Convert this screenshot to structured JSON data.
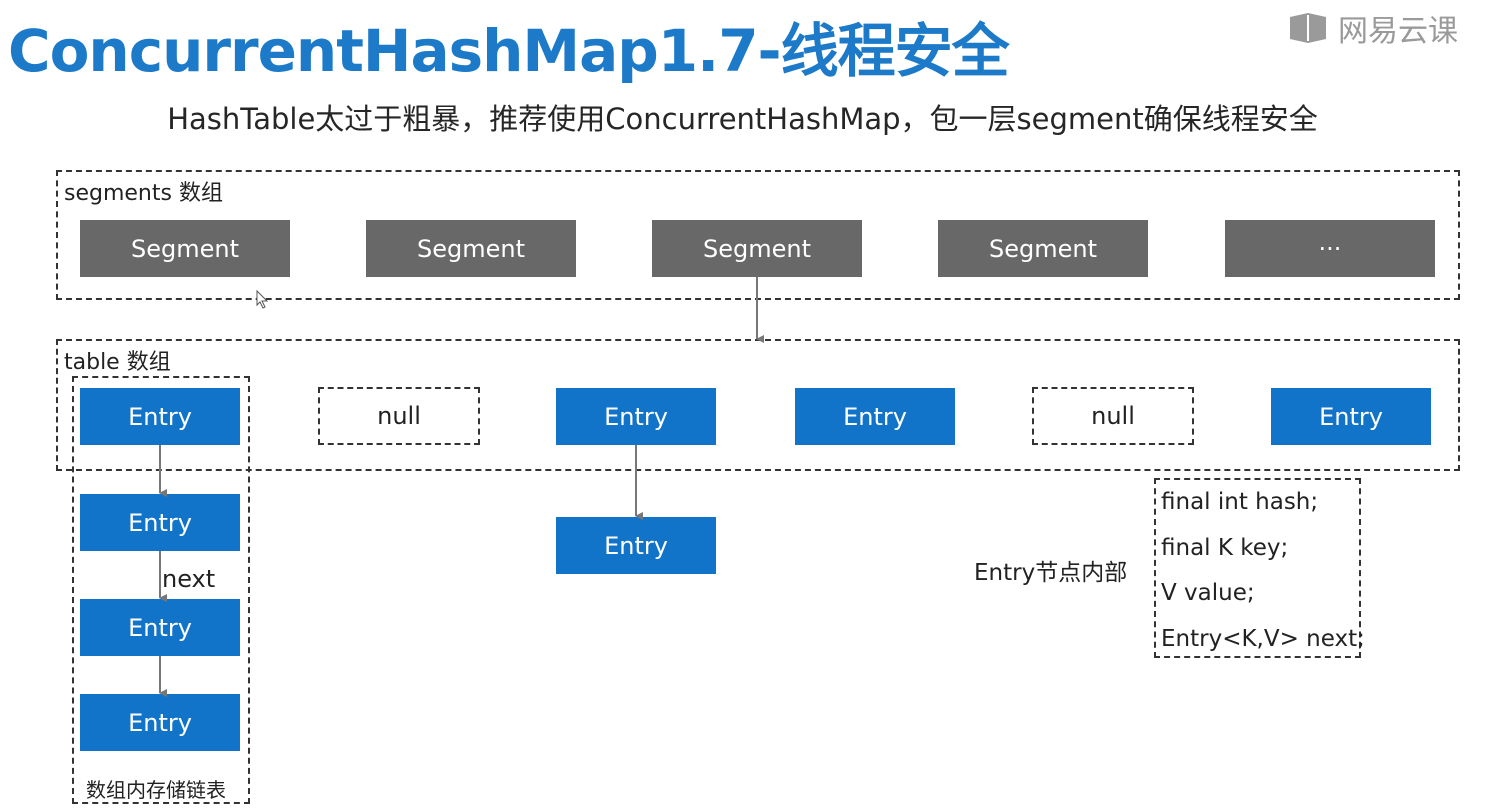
{
  "title": "ConcurrentHashMap1.7-线程安全",
  "brand": {
    "logo_text": "网易云课"
  },
  "subtitle": "HashTable太过于粗暴，推荐使用ConcurrentHashMap，包一层segment确保线程安全",
  "segments_section": {
    "label": "segments 数组",
    "items": [
      "Segment",
      "Segment",
      "Segment",
      "Segment",
      "···"
    ]
  },
  "table_section": {
    "label": "table 数组",
    "items": [
      "Entry",
      "null",
      "Entry",
      "Entry",
      "null",
      "Entry"
    ]
  },
  "chain1": {
    "items": [
      "Entry",
      "Entry",
      "Entry"
    ],
    "next_label": "next",
    "caption": "数组内存储链表"
  },
  "chain2": {
    "items": [
      "Entry"
    ]
  },
  "entry_internals": {
    "label": "Entry节点内部",
    "fields": [
      "final int hash;",
      "final K key;",
      "V value;",
      "Entry<K,V> next;"
    ]
  },
  "colors": {
    "title": "#1d7ac8",
    "segment": "#686868",
    "entry": "#1274c9",
    "logo": "#9a9a9a"
  }
}
